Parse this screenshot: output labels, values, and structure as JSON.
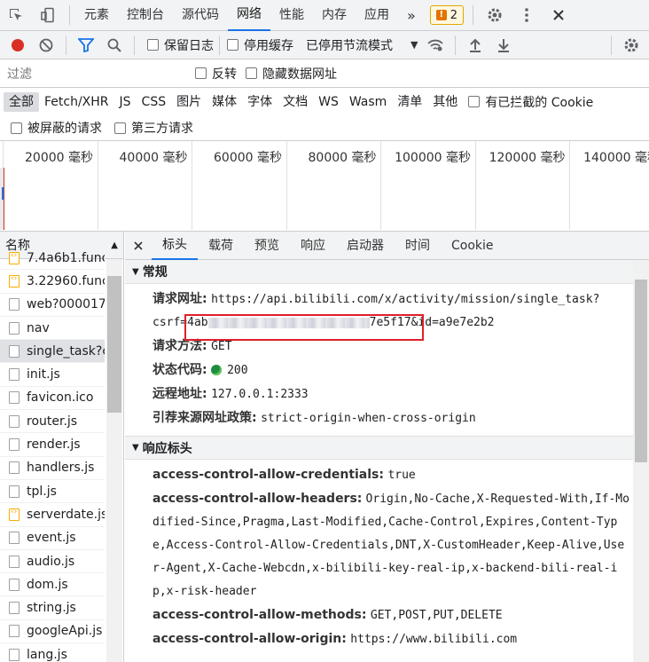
{
  "tabs": [
    "元素",
    "控制台",
    "源代码",
    "网络",
    "性能",
    "内存",
    "应用"
  ],
  "active_tab": "网络",
  "more": "»",
  "issues_count": "2",
  "toolbar": {
    "preserve_log": "保留日志",
    "disable_cache": "停用缓存",
    "throttle": "已停用节流模式"
  },
  "filter": {
    "placeholder": "过滤",
    "invert": "反转",
    "hide_data_urls": "隐藏数据网址"
  },
  "type_filters": [
    "全部",
    "Fetch/XHR",
    "JS",
    "CSS",
    "图片",
    "媒体",
    "字体",
    "文档",
    "WS",
    "Wasm",
    "清单",
    "其他"
  ],
  "blocked_cookies": "有已拦截的 Cookie",
  "blocked_requests": "被屏蔽的请求",
  "third_party": "第三方请求",
  "timeline_ticks": [
    "20000 毫秒",
    "40000 毫秒",
    "60000 毫秒",
    "80000 毫秒",
    "100000 毫秒",
    "120000 毫秒",
    "140000 毫秒"
  ],
  "name_header": "名称",
  "requests": [
    {
      "name": "7.4a6b1.func",
      "type": "js"
    },
    {
      "name": "3.22960.func",
      "type": "js"
    },
    {
      "name": "web?000017.",
      "type": "doc"
    },
    {
      "name": "nav",
      "type": "doc"
    },
    {
      "name": "single_task?c",
      "type": "doc"
    },
    {
      "name": "init.js",
      "type": "doc"
    },
    {
      "name": "favicon.ico",
      "type": "doc"
    },
    {
      "name": "router.js",
      "type": "doc"
    },
    {
      "name": "render.js",
      "type": "doc"
    },
    {
      "name": "handlers.js",
      "type": "doc"
    },
    {
      "name": "tpl.js",
      "type": "doc"
    },
    {
      "name": "serverdate.js",
      "type": "js"
    },
    {
      "name": "event.js",
      "type": "doc"
    },
    {
      "name": "audio.js",
      "type": "doc"
    },
    {
      "name": "dom.js",
      "type": "doc"
    },
    {
      "name": "string.js",
      "type": "doc"
    },
    {
      "name": "googleApi.js",
      "type": "doc"
    },
    {
      "name": "lang.js",
      "type": "doc"
    }
  ],
  "detail_tabs": [
    "标头",
    "载荷",
    "预览",
    "响应",
    "启动器",
    "时间",
    "Cookie"
  ],
  "general": {
    "title": "常规",
    "url_key": "请求网址:",
    "url_val_1": "https://api.bilibili.com/x/activity/mission/single_task?",
    "url_val_2_a": "csrf=4ab",
    "url_val_2_b": "7e5f17",
    "url_val_2_c": "&id=a9e7e2b2",
    "method_key": "请求方法:",
    "method_val": "GET",
    "status_key": "状态代码:",
    "status_val": "200",
    "remote_key": "远程地址:",
    "remote_val": "127.0.0.1:2333",
    "referrer_key": "引荐来源网址政策:",
    "referrer_val": "strict-origin-when-cross-origin"
  },
  "response_headers": {
    "title": "响应标头",
    "h1_key": "access-control-allow-credentials:",
    "h1_val": "true",
    "h2_key": "access-control-allow-headers:",
    "h2_val": "Origin,No-Cache,X-Requested-With,If-Modified-Since,Pragma,Last-Modified,Cache-Control,Expires,Content-Type,Access-Control-Allow-Credentials,DNT,X-CustomHeader,Keep-Alive,User-Agent,X-Cache-Webcdn,x-bilibili-key-real-ip,x-backend-bili-real-ip,x-risk-header",
    "h3_key": "access-control-allow-methods:",
    "h3_val": "GET,POST,PUT,DELETE",
    "h4_key": "access-control-allow-origin:",
    "h4_val": "https://www.bilibili.com"
  },
  "colors": {
    "accent": "#1a73e8",
    "record": "#d93025",
    "status_ok": "#1e8e3e",
    "highlight_box": "#e0202a"
  }
}
